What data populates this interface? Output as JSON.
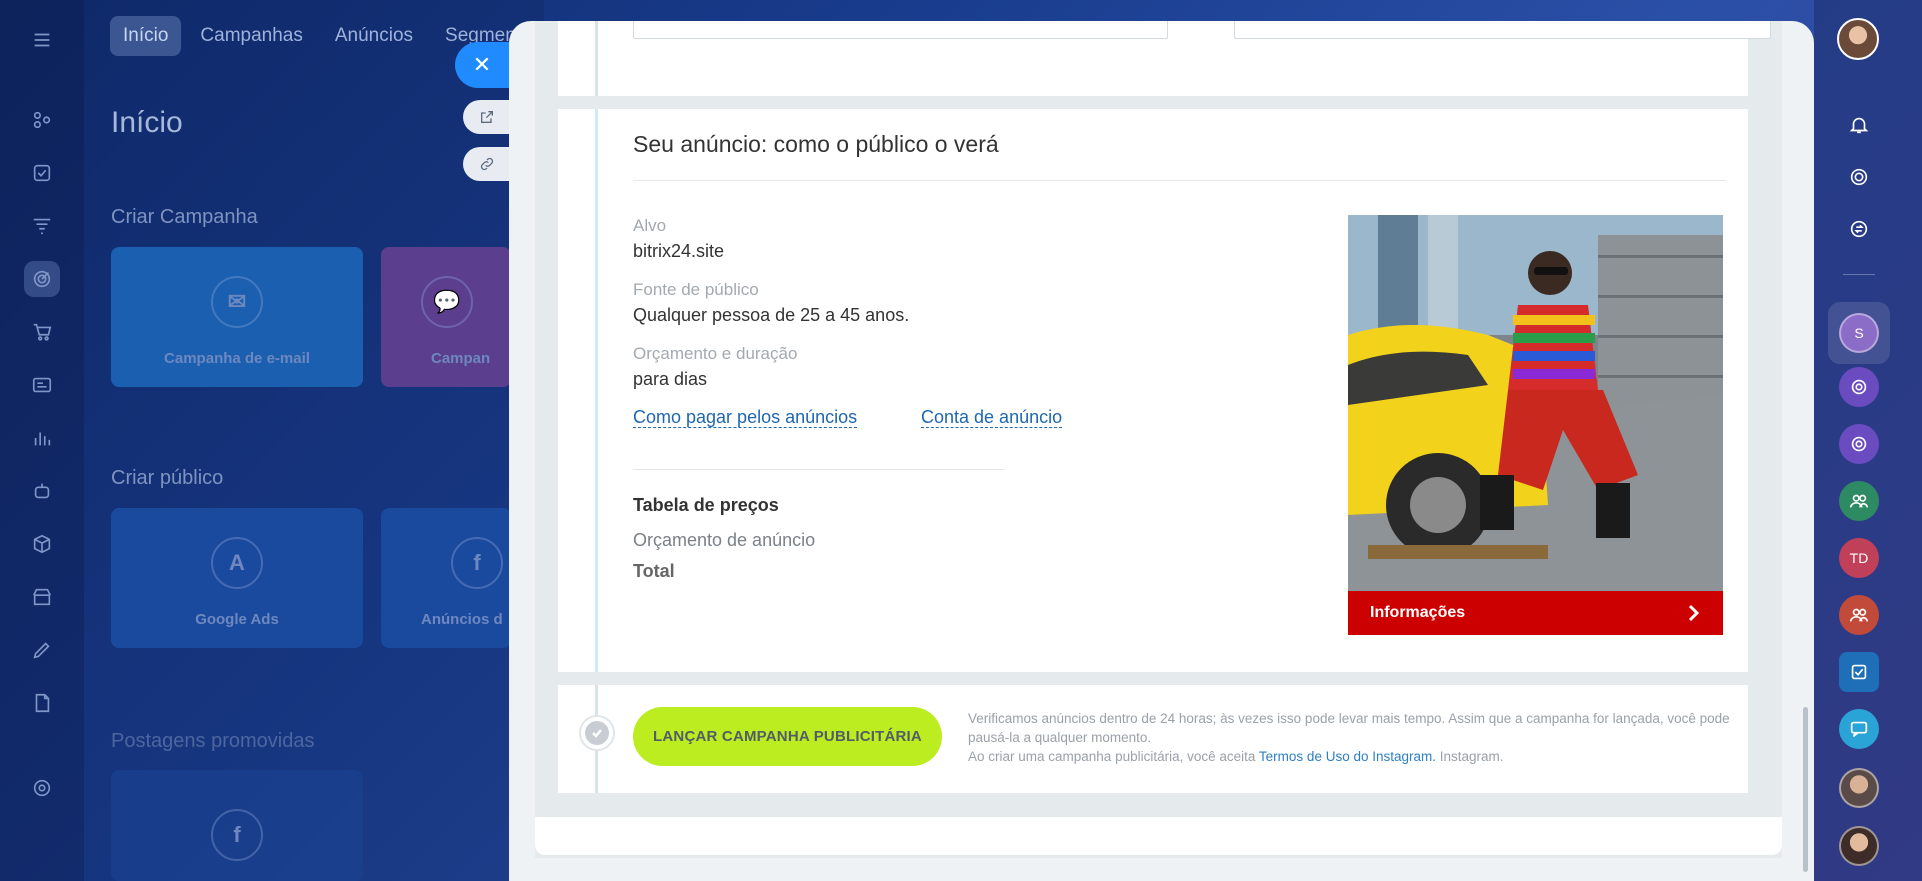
{
  "background_app": {
    "nav_tabs": [
      "Início",
      "Campanhas",
      "Anúncios",
      "Segmento"
    ],
    "page_title": "Início",
    "sections": {
      "create_campaign": "Criar Campanha",
      "create_audience": "Criar público",
      "promoted_posts": "Postagens promovidas"
    },
    "cards": {
      "email": "Campanha de e-mail",
      "sms": "Campan",
      "google_ads": "Google Ads",
      "facebook": "Anúncios d"
    }
  },
  "preview": {
    "section_title": "Seu anúncio: como o público o verá",
    "target_label": "Alvo",
    "target_value": "bitrix24.site",
    "audience_label": "Fonte de público",
    "audience_value": "Qualquer pessoa de 25 a 45 anos.",
    "budget_label": "Orçamento e duração",
    "budget_value": "para dias",
    "link_how_to_pay": "Como pagar pelos anúncios",
    "link_ad_account": "Conta de anúncio",
    "price_table_title": "Tabela de preços",
    "ad_budget_label": "Orçamento de anúncio",
    "total_label": "Total",
    "ad_cta_label": "Informações"
  },
  "launch": {
    "button_label": "LANÇAR CAMPANHA PUBLICITÁRIA",
    "note_line1": "Verificamos anúncios dentro de 24 horas; às vezes isso pode levar mais tempo. Assim que a campanha for lançada, você pode pausá-la a qualquer momento.",
    "note_line2_prefix": "Ao criar uma campanha publicitária, você aceita",
    "terms_link": "Termos de Uso do Instagram.",
    "note_line2_suffix": "Instagram."
  },
  "right_rail": {
    "avatar_s": "S",
    "avatar_td": "TD"
  },
  "colors": {
    "launch_button": "#bbed21",
    "cta_red": "#cc0000",
    "close_blue": "#1f8bff",
    "link_blue": "#2067b0"
  }
}
